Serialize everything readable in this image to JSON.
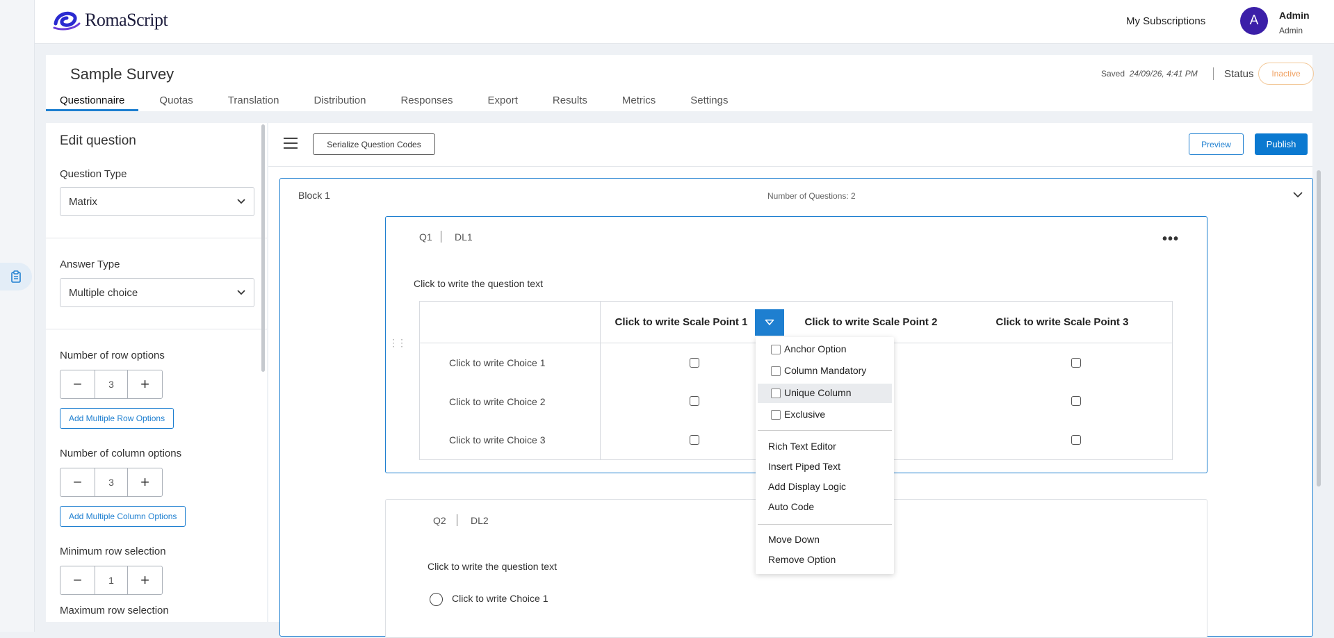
{
  "app": {
    "logo_text": "RomaScript"
  },
  "header": {
    "my_subscriptions": "My Subscriptions",
    "user": {
      "avatar_letter": "A",
      "name": "Admin",
      "role": "Admin"
    }
  },
  "survey": {
    "title": "Sample Survey",
    "saved_label": "Saved",
    "saved_time": "24/09/26, 4:41 PM",
    "status_label": "Status",
    "status_value": "Inactive",
    "tabs": [
      {
        "label": "Questionnaire",
        "active": true
      },
      {
        "label": "Quotas"
      },
      {
        "label": "Translation"
      },
      {
        "label": "Distribution"
      },
      {
        "label": "Responses"
      },
      {
        "label": "Export"
      },
      {
        "label": "Results"
      },
      {
        "label": "Metrics"
      },
      {
        "label": "Settings"
      }
    ]
  },
  "edit_panel": {
    "title": "Edit question",
    "question_type_label": "Question Type",
    "question_type_value": "Matrix",
    "answer_type_label": "Answer Type",
    "answer_type_value": "Multiple choice",
    "row_options_label": "Number of row options",
    "row_options_value": "3",
    "add_rows_button": "Add Multiple Row Options",
    "column_options_label": "Number of column options",
    "column_options_value": "3",
    "add_columns_button": "Add Multiple Column Options",
    "min_row_label": "Minimum row selection",
    "min_row_value": "1",
    "max_row_label": "Maximum row selection"
  },
  "toolbar": {
    "serialize_button": "Serialize Question Codes",
    "preview_button": "Preview",
    "publish_button": "Publish"
  },
  "block": {
    "title": "Block 1",
    "count_text": "Number of Questions: 2"
  },
  "q1": {
    "number": "Q1",
    "code": "DL1",
    "text": "Click to write the question text",
    "columns": [
      "Click to write Scale Point 1",
      "Click to write Scale Point 2",
      "Click to write Scale Point 3"
    ],
    "rows": [
      "Click to write Choice 1",
      "Click to write Choice 2",
      "Click to write Choice 3"
    ]
  },
  "column_menu": {
    "checkbox_items": [
      "Anchor Option",
      "Column Mandatory",
      "Unique Column",
      "Exclusive"
    ],
    "highlighted": "Unique Column",
    "actions": [
      "Rich Text Editor",
      "Insert Piped Text",
      "Add Display Logic",
      "Auto Code"
    ],
    "more_actions": [
      "Move Down",
      "Remove Option"
    ]
  },
  "q2": {
    "number": "Q2",
    "code": "DL2",
    "text": "Click to write the question text",
    "choices": [
      "Click to write Choice 1"
    ]
  },
  "colors": {
    "accent": "#1e7fd0",
    "avatar": "#3b1fa8",
    "inactive": "#f0a060"
  }
}
